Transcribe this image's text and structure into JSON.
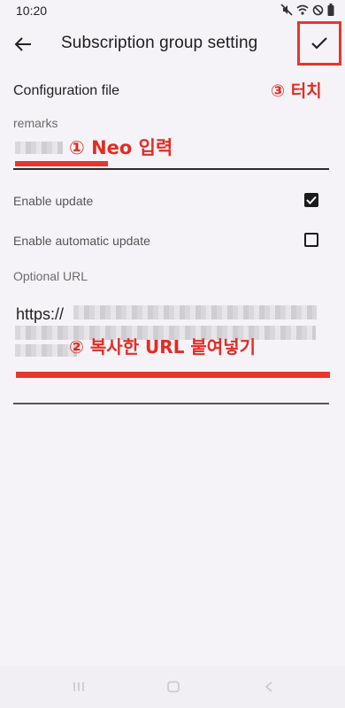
{
  "status": {
    "time": "10:20"
  },
  "header": {
    "title": "Subscription group setting"
  },
  "form": {
    "section_title": "Configuration file",
    "remarks_label": "remarks",
    "enable_update_label": "Enable update",
    "enable_update_checked": true,
    "enable_auto_update_label": "Enable automatic update",
    "enable_auto_update_checked": false,
    "optional_url_label": "Optional URL",
    "url_value_prefix": "https://"
  },
  "annotations": {
    "step1": "① Neo 입력",
    "step2": "② 복사한 URL 붙여넣기",
    "step3": "③ 터치"
  },
  "colors": {
    "annotation_red": "#e8352e",
    "background": "#f5f3f7"
  },
  "icons": {
    "back": "arrow-left-icon",
    "confirm": "check-icon",
    "status": [
      "mute-icon",
      "wifi-icon",
      "block-icon",
      "battery-icon"
    ],
    "nav": [
      "recents-icon",
      "home-icon",
      "back-nav-icon"
    ]
  }
}
